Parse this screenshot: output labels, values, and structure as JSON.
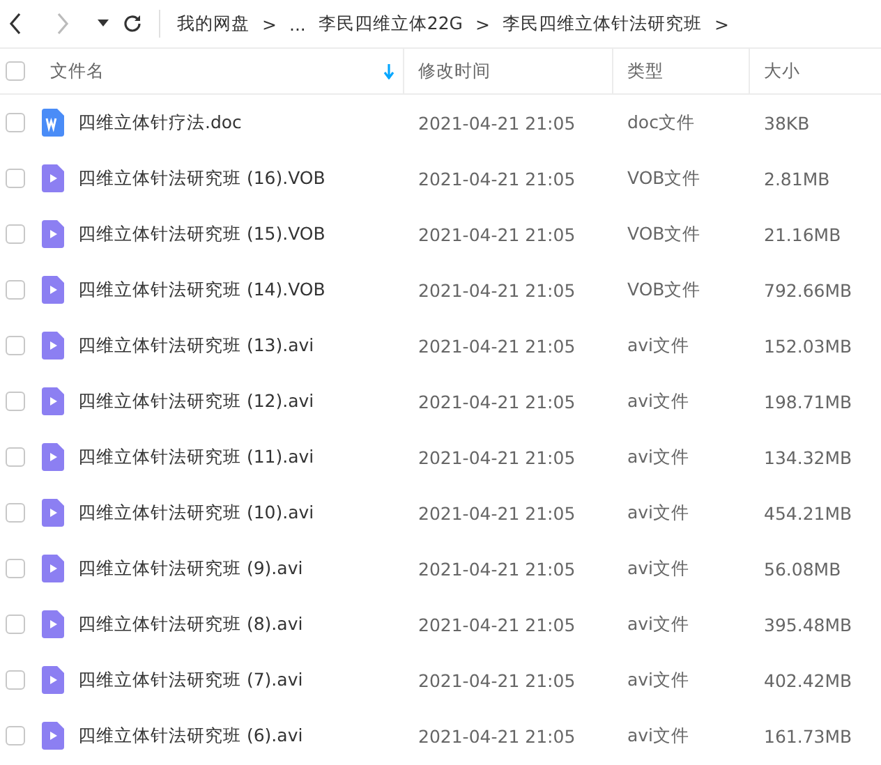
{
  "toolbar": {
    "breadcrumbs": [
      "我的网盘",
      ">",
      "...",
      "李民四维立体22G",
      ">",
      "李民四维立体针法研究班",
      ">"
    ]
  },
  "table": {
    "all_selected": false,
    "columns": [
      "文件名",
      "修改时间",
      "类型",
      "大小"
    ],
    "rows": [
      {
        "kind": "doc",
        "selected": false,
        "name": "四维立体针疗法.doc",
        "modified": "2021-04-21 21:05",
        "type": "doc文件",
        "size": "38KB"
      },
      {
        "kind": "video",
        "selected": false,
        "name": "四维立体针法研究班 (16).VOB",
        "modified": "2021-04-21 21:05",
        "type": "VOB文件",
        "size": "2.81MB"
      },
      {
        "kind": "video",
        "selected": false,
        "name": "四维立体针法研究班 (15).VOB",
        "modified": "2021-04-21 21:05",
        "type": "VOB文件",
        "size": "21.16MB"
      },
      {
        "kind": "video",
        "selected": false,
        "name": "四维立体针法研究班 (14).VOB",
        "modified": "2021-04-21 21:05",
        "type": "VOB文件",
        "size": "792.66MB"
      },
      {
        "kind": "video",
        "selected": false,
        "name": "四维立体针法研究班 (13).avi",
        "modified": "2021-04-21 21:05",
        "type": "avi文件",
        "size": "152.03MB"
      },
      {
        "kind": "video",
        "selected": false,
        "name": "四维立体针法研究班 (12).avi",
        "modified": "2021-04-21 21:05",
        "type": "avi文件",
        "size": "198.71MB"
      },
      {
        "kind": "video",
        "selected": false,
        "name": "四维立体针法研究班 (11).avi",
        "modified": "2021-04-21 21:05",
        "type": "avi文件",
        "size": "134.32MB"
      },
      {
        "kind": "video",
        "selected": false,
        "name": "四维立体针法研究班 (10).avi",
        "modified": "2021-04-21 21:05",
        "type": "avi文件",
        "size": "454.21MB"
      },
      {
        "kind": "video",
        "selected": false,
        "name": "四维立体针法研究班 (9).avi",
        "modified": "2021-04-21 21:05",
        "type": "avi文件",
        "size": "56.08MB"
      },
      {
        "kind": "video",
        "selected": false,
        "name": "四维立体针法研究班 (8).avi",
        "modified": "2021-04-21 21:05",
        "type": "avi文件",
        "size": "395.48MB"
      },
      {
        "kind": "video",
        "selected": false,
        "name": "四维立体针法研究班 (7).avi",
        "modified": "2021-04-21 21:05",
        "type": "avi文件",
        "size": "402.42MB"
      },
      {
        "kind": "video",
        "selected": false,
        "name": "四维立体针法研究班 (6).avi",
        "modified": "2021-04-21 21:05",
        "type": "avi文件",
        "size": "161.73MB"
      }
    ]
  }
}
